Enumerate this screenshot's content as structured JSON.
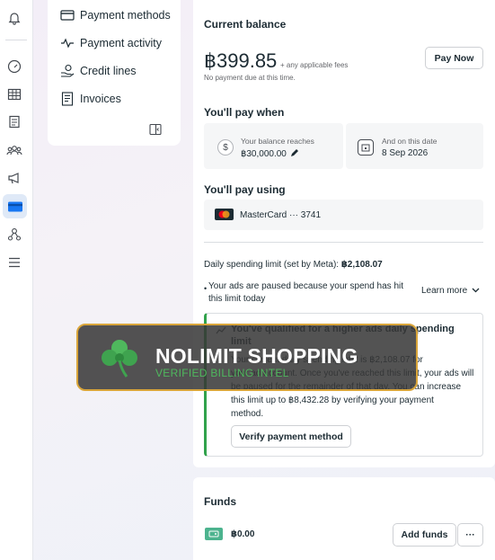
{
  "subnav": {
    "items": [
      {
        "label": "Payment methods",
        "icon": "card-icon"
      },
      {
        "label": "Payment activity",
        "icon": "activity-icon"
      },
      {
        "label": "Credit lines",
        "icon": "hand-coin-icon"
      },
      {
        "label": "Invoices",
        "icon": "invoice-icon"
      }
    ]
  },
  "balance": {
    "title": "Current balance",
    "amount": "฿399.85",
    "amount_note": "+ any applicable fees",
    "due_note": "No payment due at this time.",
    "pay_now": "Pay Now"
  },
  "pay_when": {
    "title": "You'll pay when",
    "threshold_label": "Your balance reaches",
    "threshold_value": "฿30,000.00",
    "date_label": "And on this date",
    "date_value": "8 Sep 2026"
  },
  "pay_using": {
    "title": "You'll pay using",
    "method": "MasterCard ··· 3741"
  },
  "spending": {
    "limit_label": "Daily spending limit (set by Meta):",
    "limit_value": "฿2,108.07",
    "paused_line1": "Your ads are paused because your spend has hit",
    "paused_line2": "this limit today",
    "learn_more": "Learn more"
  },
  "qualify": {
    "title_line1": "You've qualified for a higher ads daily spending",
    "title_line2": "limit",
    "body_line1": "Your current daily spending limit is ฿2,108.07 for",
    "body_line2": "your ad account. Once you've reached this limit, your ads will",
    "body_line3": "be paused for the remainder of that day. You can increase",
    "body_line4": "this limit up to ฿8,432.28 by verifying your payment",
    "body_line5": "method.",
    "verify_button": "Verify payment method"
  },
  "funds": {
    "title": "Funds",
    "amount": "฿0.00",
    "add_funds": "Add funds",
    "more": "···"
  },
  "watermark": {
    "title": "NOLIMIT SHOPPING",
    "subtitle": "VERIFIED BILLING INTEL"
  },
  "colors": {
    "accent_blue": "#1877f2",
    "active_bg": "#dfe9f7",
    "green_bar": "#31a24c",
    "banner_border": "#d9a53a"
  }
}
